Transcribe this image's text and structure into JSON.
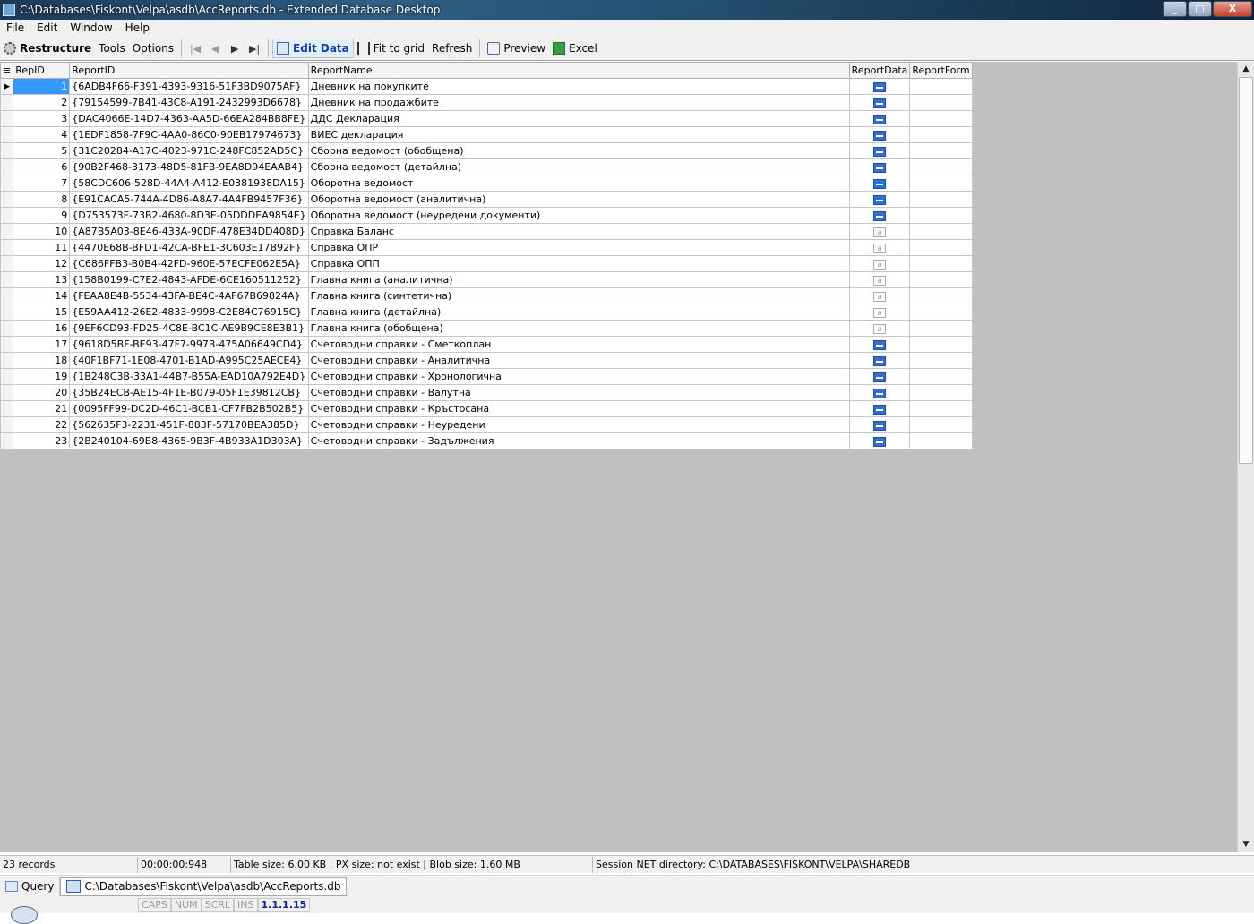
{
  "window": {
    "title": "C:\\Databases\\Fiskont\\Velpa\\asdb\\AccReports.db - Extended Database Desktop",
    "controls": [
      "_",
      "□",
      "X"
    ]
  },
  "menu": [
    "File",
    "Edit",
    "Window",
    "Help"
  ],
  "toolbar": {
    "restructure": "Restructure",
    "tools": "Tools",
    "options": "Options",
    "nav_first": "|◀",
    "nav_prev": "◀",
    "nav_next": "▶",
    "nav_last": "▶|",
    "edit_data": "Edit Data",
    "fit_to_grid": "Fit to grid",
    "refresh": "Refresh",
    "preview": "Preview",
    "excel": "Excel"
  },
  "grid": {
    "columns": [
      "RepID",
      "ReportID",
      "ReportName",
      "ReportData",
      "ReportForm"
    ],
    "rows": [
      {
        "id": "1",
        "guid": "{6ADB4F66-F391-4393-9316-51F3BD9075AF}",
        "name": "Дневник на покупките",
        "data": "bin"
      },
      {
        "id": "2",
        "guid": "{79154599-7B41-43C8-A191-2432993D6678}",
        "name": "Дневник на продажбите",
        "data": "bin"
      },
      {
        "id": "3",
        "guid": "{DAC4066E-14D7-4363-AA5D-66EA284BB8FE}",
        "name": "ДДС Декларация",
        "data": "bin"
      },
      {
        "id": "4",
        "guid": "{1EDF1858-7F9C-4AA0-86C0-90EB17974673}",
        "name": "ВИЕС декларация",
        "data": "bin"
      },
      {
        "id": "5",
        "guid": "{31C20284-A17C-4023-971C-248FC852AD5C}",
        "name": "Сборна ведомост (обобщена)",
        "data": "bin"
      },
      {
        "id": "6",
        "guid": "{90B2F468-3173-48D5-81FB-9EA8D94EAAB4}",
        "name": "Сборна ведомост (детайлна)",
        "data": "bin"
      },
      {
        "id": "7",
        "guid": "{58CDC606-528D-44A4-A412-E0381938DA15}",
        "name": "Оборотна ведомост",
        "data": "bin"
      },
      {
        "id": "8",
        "guid": "{E91CACA5-744A-4D86-A8A7-4A4FB9457F36}",
        "name": "Оборотна ведомост (аналитична)",
        "data": "bin"
      },
      {
        "id": "9",
        "guid": "{D753573F-73B2-4680-8D3E-05DDDEA9854E}",
        "name": "Оборотна ведомост (неуредени документи)",
        "data": "bin"
      },
      {
        "id": "10",
        "guid": "{A87B5A03-8E46-433A-90DF-478E34DD408D}",
        "name": "Справка Баланс",
        "data": "txt"
      },
      {
        "id": "11",
        "guid": "{4470E68B-BFD1-42CA-BFE1-3C603E17B92F}",
        "name": "Справка ОПР",
        "data": "txt"
      },
      {
        "id": "12",
        "guid": "{C686FFB3-B0B4-42FD-960E-57ECFE062E5A}",
        "name": "Справка ОПП",
        "data": "txt"
      },
      {
        "id": "13",
        "guid": "{158B0199-C7E2-4843-AFDE-6CE160511252}",
        "name": "Главна книга (аналитична)",
        "data": "txt"
      },
      {
        "id": "14",
        "guid": "{FEAA8E4B-5534-43FA-BE4C-4AF67B69824A}",
        "name": "Главна книга (синтетична)",
        "data": "txt"
      },
      {
        "id": "15",
        "guid": "{E59AA412-26E2-4833-9998-C2E84C76915C}",
        "name": "Главна книга (детайлна)",
        "data": "txt"
      },
      {
        "id": "16",
        "guid": "{9EF6CD93-FD25-4C8E-BC1C-AE9B9CE8E3B1}",
        "name": "Главна книга (обобщена)",
        "data": "txt"
      },
      {
        "id": "17",
        "guid": "{9618D5BF-BE93-47F7-997B-475A06649CD4}",
        "name": "Счетоводни справки - Сметкоплан",
        "data": "bin"
      },
      {
        "id": "18",
        "guid": "{40F1BF71-1E08-4701-B1AD-A995C25AECE4}",
        "name": "Счетоводни справки - Аналитична",
        "data": "bin"
      },
      {
        "id": "19",
        "guid": "{1B248C3B-33A1-44B7-B55A-EAD10A792E4D}",
        "name": "Счетоводни справки - Хронологична",
        "data": "bin"
      },
      {
        "id": "20",
        "guid": "{35B24ECB-AE15-4F1E-B079-05F1E39812CB}",
        "name": "Счетоводни справки - Валутна",
        "data": "bin"
      },
      {
        "id": "21",
        "guid": "{0095FF99-DC2D-46C1-BCB1-CF7FB2B502B5}",
        "name": "Счетоводни справки - Кръстосана",
        "data": "bin"
      },
      {
        "id": "22",
        "guid": "{562635F3-2231-451F-883F-57170BEA385D}",
        "name": "Счетоводни справки - Неуредени",
        "data": "bin"
      },
      {
        "id": "23",
        "guid": "{2B240104-69B8-4365-9B3F-4B933A1D303A}",
        "name": "Счетоводни справки - Задължения",
        "data": "bin"
      }
    ]
  },
  "status": {
    "records": "23 records",
    "elapsed": "00:00:00:948",
    "sizes": "Table size: 6.00 KB | PX size: not exist | Blob size: 1.60 MB",
    "session": "Session NET directory: C:\\DATABASES\\FISKONT\\VELPA\\SHAREDB"
  },
  "tasks": {
    "query": "Query",
    "db_tab": "C:\\Databases\\Fiskont\\Velpa\\asdb\\AccReports.db"
  },
  "keys": [
    "CAPS",
    "NUM",
    "SCRL",
    "INS"
  ],
  "version": "1.1.1.15",
  "icons": {
    "gear": "gear-icon",
    "edit": "edit-data-icon",
    "fit": "fit-to-grid-icon",
    "preview": "preview-icon",
    "excel": "excel-icon",
    "binary_blob": "binary-blob-icon",
    "text_blob": "text-blob-icon"
  }
}
